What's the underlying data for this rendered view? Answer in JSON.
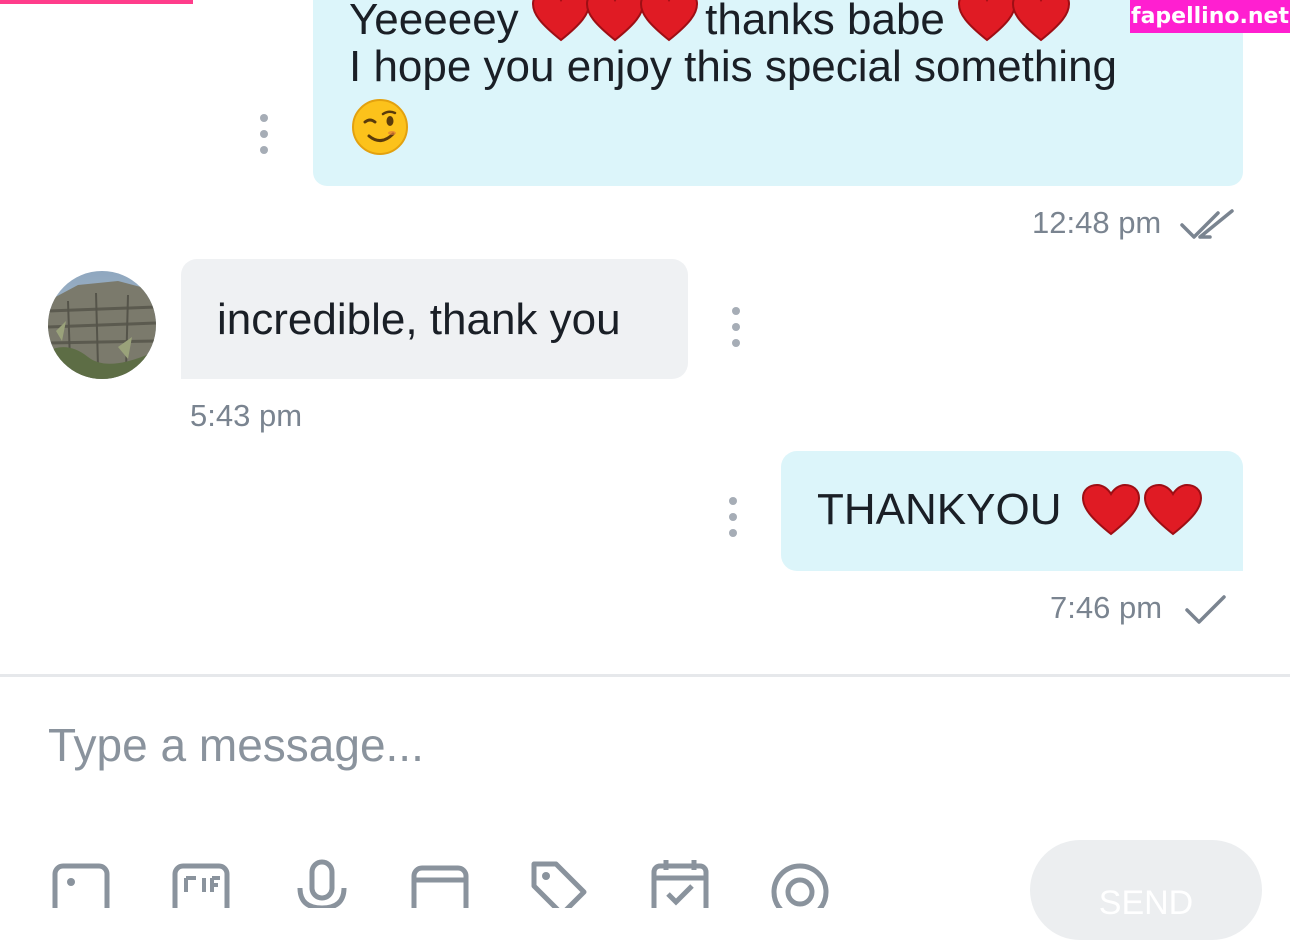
{
  "watermark": {
    "text": "fapellino.net"
  },
  "messages": [
    {
      "direction": "outgoing",
      "line1_a": "Yeeeeey",
      "line1_b": "thanks babe",
      "line2": "I hope you enjoy this special something",
      "emoji": "winking-face",
      "time": "12:48 pm",
      "status": "read-double-check"
    },
    {
      "direction": "incoming",
      "text": "incredible, thank you",
      "time": "5:43 pm"
    },
    {
      "direction": "outgoing",
      "text": "THANKYOU",
      "emoji": "two-red-hearts",
      "time": "7:46 pm",
      "status": "sent-single-check"
    }
  ],
  "composer": {
    "placeholder": "Type a message...",
    "send_label": "SEND",
    "tools": [
      "image-icon",
      "gif-icon",
      "microphone-icon",
      "wallet-icon",
      "price-tag-icon",
      "schedule-icon",
      "quiz-icon"
    ]
  },
  "colors": {
    "sent_bubble": "#dcf5fa",
    "received_bubble": "#eff1f3",
    "watermark": "#ff1fd0",
    "muted_text": "#7a8490"
  }
}
